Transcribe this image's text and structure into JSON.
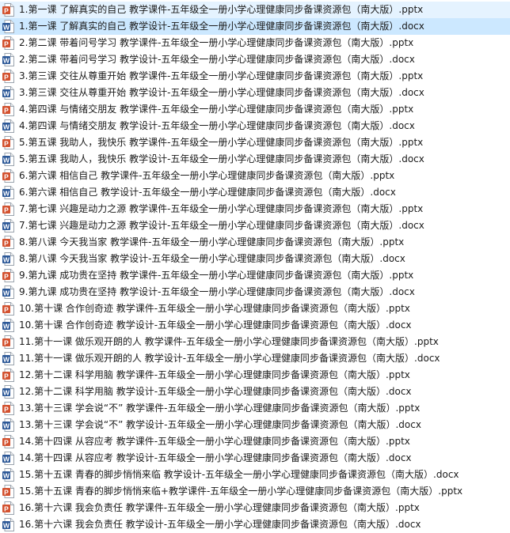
{
  "files": [
    {
      "name": "1.第一课  了解真实的自己 教学课件-五年级全一册小学心理健康同步备课资源包（南大版）.pptx",
      "type": "pptx",
      "state": "hover"
    },
    {
      "name": "1.第一课  了解真实的自己 教学设计-五年级全一册小学心理健康同步备课资源包（南大版）.docx",
      "type": "docx",
      "state": "selected"
    },
    {
      "name": "2.第二课  带着问号学习 教学课件-五年级全一册小学心理健康同步备课资源包（南大版）.pptx",
      "type": "pptx",
      "state": ""
    },
    {
      "name": "2.第二课  带着问号学习 教学设计-五年级全一册小学心理健康同步备课资源包（南大版）.docx",
      "type": "docx",
      "state": ""
    },
    {
      "name": "3.第三课  交往从尊重开始 教学课件-五年级全一册小学心理健康同步备课资源包（南大版）.pptx",
      "type": "pptx",
      "state": ""
    },
    {
      "name": "3.第三课  交往从尊重开始 教学设计-五年级全一册小学心理健康同步备课资源包（南大版）.docx",
      "type": "docx",
      "state": ""
    },
    {
      "name": "4.第四课  与情绪交朋友 教学课件-五年级全一册小学心理健康同步备课资源包（南大版）.pptx",
      "type": "pptx",
      "state": ""
    },
    {
      "name": "4.第四课  与情绪交朋友 教学设计-五年级全一册小学心理健康同步备课资源包（南大版）.docx",
      "type": "docx",
      "state": ""
    },
    {
      "name": "5.第五课  我助人，我快乐 教学课件-五年级全一册小学心理健康同步备课资源包（南大版）.pptx",
      "type": "pptx",
      "state": ""
    },
    {
      "name": "5.第五课  我助人，我快乐 教学设计-五年级全一册小学心理健康同步备课资源包（南大版）.docx",
      "type": "docx",
      "state": ""
    },
    {
      "name": "6.第六课  相信自己 教学课件-五年级全一册小学心理健康同步备课资源包（南大版）.pptx",
      "type": "pptx",
      "state": ""
    },
    {
      "name": "6.第六课  相信自己 教学设计-五年级全一册小学心理健康同步备课资源包（南大版）.docx",
      "type": "docx",
      "state": ""
    },
    {
      "name": "7.第七课  兴趣是动力之源 教学课件-五年级全一册小学心理健康同步备课资源包（南大版）.pptx",
      "type": "pptx",
      "state": ""
    },
    {
      "name": "7.第七课  兴趣是动力之源 教学设计-五年级全一册小学心理健康同步备课资源包（南大版）.docx",
      "type": "docx",
      "state": ""
    },
    {
      "name": "8.第八课  今天我当家 教学课件-五年级全一册小学心理健康同步备课资源包（南大版）.pptx",
      "type": "pptx",
      "state": ""
    },
    {
      "name": "8.第八课  今天我当家 教学设计-五年级全一册小学心理健康同步备课资源包（南大版）.docx",
      "type": "docx",
      "state": ""
    },
    {
      "name": "9.第九课  成功贵在坚持 教学课件-五年级全一册小学心理健康同步备课资源包（南大版）.pptx",
      "type": "pptx",
      "state": ""
    },
    {
      "name": "9.第九课  成功贵在坚持 教学设计-五年级全一册小学心理健康同步备课资源包（南大版）.docx",
      "type": "docx",
      "state": ""
    },
    {
      "name": "10.第十课  合作创奇迹 教学课件-五年级全一册小学心理健康同步备课资源包（南大版）.pptx",
      "type": "pptx",
      "state": ""
    },
    {
      "name": "10.第十课  合作创奇迹 教学设计-五年级全一册小学心理健康同步备课资源包（南大版）.docx",
      "type": "docx",
      "state": ""
    },
    {
      "name": "11.第十一课  做乐观开朗的人 教学课件-五年级全一册小学心理健康同步备课资源包（南大版）.pptx",
      "type": "pptx",
      "state": ""
    },
    {
      "name": "11.第十一课  做乐观开朗的人 教学设计-五年级全一册小学心理健康同步备课资源包（南大版）.docx",
      "type": "docx",
      "state": ""
    },
    {
      "name": "12.第十二课  科学用脑 教学课件-五年级全一册小学心理健康同步备课资源包（南大版）.pptx",
      "type": "pptx",
      "state": ""
    },
    {
      "name": "12.第十二课  科学用脑 教学设计-五年级全一册小学心理健康同步备课资源包（南大版）.docx",
      "type": "docx",
      "state": ""
    },
    {
      "name": "13.第十三课  学会说“不” 教学课件-五年级全一册小学心理健康同步备课资源包（南大版）.pptx",
      "type": "pptx",
      "state": ""
    },
    {
      "name": "13.第十三课  学会说“不” 教学设计-五年级全一册小学心理健康同步备课资源包（南大版）.docx",
      "type": "docx",
      "state": ""
    },
    {
      "name": "14.第十四课  从容应考 教学课件-五年级全一册小学心理健康同步备课资源包（南大版）.pptx",
      "type": "pptx",
      "state": ""
    },
    {
      "name": "14.第十四课  从容应考 教学设计-五年级全一册小学心理健康同步备课资源包（南大版）.docx",
      "type": "docx",
      "state": ""
    },
    {
      "name": "15.第十五课  青春的脚步悄悄来临 教学设计-五年级全一册小学心理健康同步备课资源包（南大版）.docx",
      "type": "docx",
      "state": ""
    },
    {
      "name": "15.第十五课  青春的脚步悄悄来临+教学课件-五年级全一册小学心理健康同步备课资源包（南大版）.pptx",
      "type": "pptx",
      "state": ""
    },
    {
      "name": "16.第十六课  我会负责任 教学课件-五年级全一册小学心理健康同步备课资源包（南大版）.pptx",
      "type": "pptx",
      "state": ""
    },
    {
      "name": "16.第十六课  我会负责任 教学设计-五年级全一册小学心理健康同步备课资源包（南大版）.docx",
      "type": "docx",
      "state": ""
    }
  ],
  "icons": {
    "pptx": {
      "name": "powerpoint-file-icon",
      "color": "#d35230",
      "letter": "P"
    },
    "docx": {
      "name": "word-file-icon",
      "color": "#2b5797",
      "letter": "W"
    }
  },
  "colors": {
    "selected": "#cce8ff",
    "hover": "#e5f3ff"
  }
}
